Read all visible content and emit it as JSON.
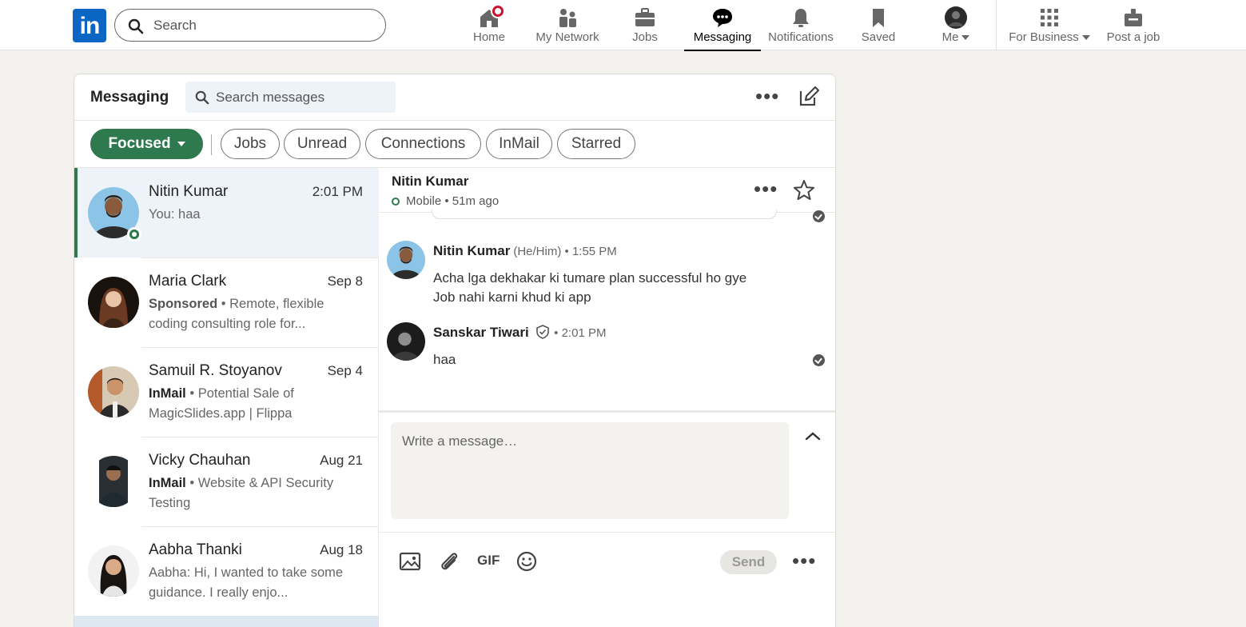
{
  "nav": {
    "logo": "in",
    "search_placeholder": "Search",
    "items": [
      {
        "label": "Home",
        "icon": "home-icon"
      },
      {
        "label": "My Network",
        "icon": "network-icon"
      },
      {
        "label": "Jobs",
        "icon": "briefcase-icon"
      },
      {
        "label": "Messaging",
        "icon": "messaging-icon",
        "active": true
      },
      {
        "label": "Notifications",
        "icon": "bell-icon"
      },
      {
        "label": "Saved",
        "icon": "bookmark-icon"
      },
      {
        "label": "Me",
        "icon": "avatar"
      },
      {
        "label": "For Business",
        "icon": "grid-icon"
      },
      {
        "label": "Post a job",
        "icon": "post-job-icon"
      }
    ]
  },
  "messaging": {
    "title": "Messaging",
    "search_placeholder": "Search messages",
    "filters": [
      "Focused",
      "Jobs",
      "Unread",
      "Connections",
      "InMail",
      "Starred"
    ]
  },
  "conversations": [
    {
      "name": "Nitin Kumar",
      "time": "2:01 PM",
      "preview": "You: haa",
      "tag": ""
    },
    {
      "name": "Maria Clark",
      "time": "Sep 8",
      "tag": "Sponsored",
      "preview": "Remote, flexible coding consulting role for..."
    },
    {
      "name": "Samuil R. Stoyanov",
      "time": "Sep 4",
      "tag": "InMail",
      "preview": "Potential Sale of MagicSlides.app | Flippa"
    },
    {
      "name": "Vicky Chauhan",
      "time": "Aug 21",
      "tag": "InMail",
      "preview": "Website & API Security Testing"
    },
    {
      "name": "Aabha Thanki",
      "time": "Aug 18",
      "tag": "",
      "preview": "Aabha: Hi, I wanted to take some guidance. I really enjo..."
    }
  ],
  "thread": {
    "name": "Nitin Kumar",
    "status": "Mobile",
    "last_seen": "51m ago",
    "messages": [
      {
        "sender": "Nitin Kumar",
        "pronouns": "(He/Him)",
        "time": "1:55 PM",
        "lines": [
          "Acha lga dekhakar ki tumare plan successful ho gye",
          "Job nahi karni khud ki app"
        ]
      },
      {
        "sender": "Sanskar Tiwari",
        "time": "2:01 PM",
        "lines": [
          "haa"
        ]
      }
    ],
    "composer_placeholder": "Write a message…",
    "gif_label": "GIF",
    "send_label": "Send"
  },
  "colors": {
    "brand": "#0a66c2",
    "focused": "#2e7a4e",
    "badge": "#cb112d"
  }
}
